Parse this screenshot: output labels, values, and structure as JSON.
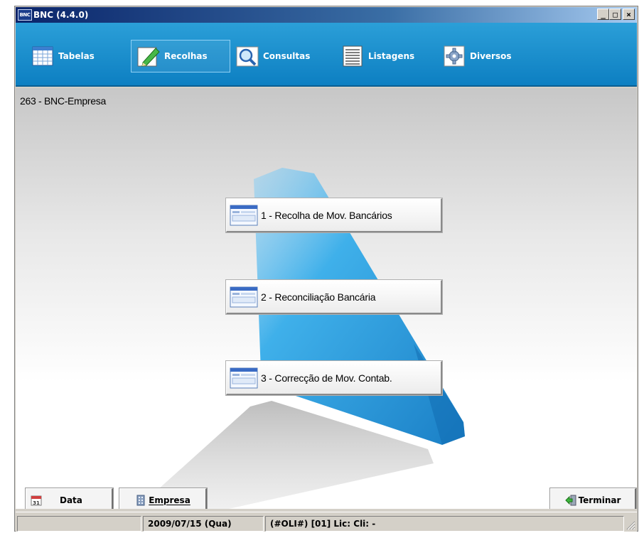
{
  "window": {
    "title": "BNC (4.4.0)",
    "icon_text": "BNC",
    "controls": {
      "minimize": "_",
      "maximize": "□",
      "close": "×"
    }
  },
  "toolbar": {
    "items": [
      {
        "label": "Tabelas",
        "icon": "table-grid-icon",
        "active": false
      },
      {
        "label": "Recolhas",
        "icon": "pencil-icon",
        "active": true
      },
      {
        "label": "Consultas",
        "icon": "magnifier-icon",
        "active": false
      },
      {
        "label": "Listagens",
        "icon": "list-document-icon",
        "active": false
      },
      {
        "label": "Diversos",
        "icon": "gear-icon",
        "active": false
      }
    ]
  },
  "main": {
    "company": "263 - BNC-Empresa",
    "actions": [
      {
        "label": "1 - Recolha de Mov. Bancários",
        "icon": "form-window-icon"
      },
      {
        "label": "2 - Reconciliação Bancária",
        "icon": "form-window-icon"
      },
      {
        "label": "3 - Correcção de Mov. Contab.",
        "icon": "form-window-icon"
      }
    ]
  },
  "bottom": {
    "data_label": "Data",
    "empresa_label": "Empresa",
    "terminar_label": "Terminar"
  },
  "statusbar": {
    "date": "2009/07/15 (Qua)",
    "info": "(#OLI#) [01] Lic:  Cli:  -"
  },
  "colors": {
    "toolbar": "#1890d0",
    "titlebar": "#0a246a",
    "accent_shape": "#2aa2de"
  }
}
